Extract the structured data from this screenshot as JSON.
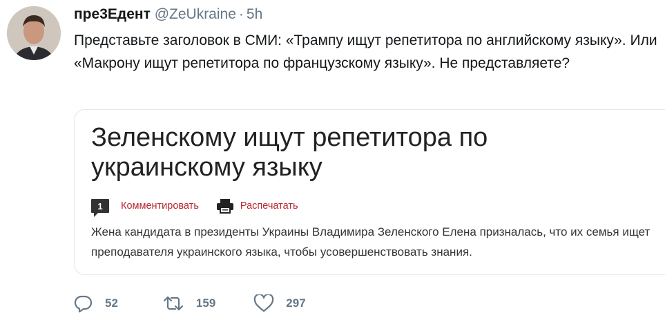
{
  "tweet": {
    "author_name": "пре3Едент",
    "handle": "@ZeUkraine",
    "separator": "·",
    "time": "5h",
    "text": "Представьте заголовок в СМИ: «Трампу ищут репетитора по английскому языку». Или «Макрону ищут репетитора по французскому языку». Не представляете?"
  },
  "card": {
    "title": "Зеленскому ищут репетитора по украинскому языку",
    "comment_count": "1",
    "comment_label": "Комментировать",
    "print_label": "Распечатать",
    "description": "Жена кандидата в президенты Украины Владимира Зеленского Елена призналась, что их семья ищет преподавателя украинского языка, чтобы усовершенствовать знания.",
    "link_color": "#b8252f"
  },
  "actions": {
    "replies": "52",
    "retweets": "159",
    "likes": "297"
  },
  "icons": {
    "reply": "reply-icon",
    "retweet": "retweet-icon",
    "like": "heart-icon",
    "print": "printer-icon",
    "comments": "comment-count-icon"
  }
}
